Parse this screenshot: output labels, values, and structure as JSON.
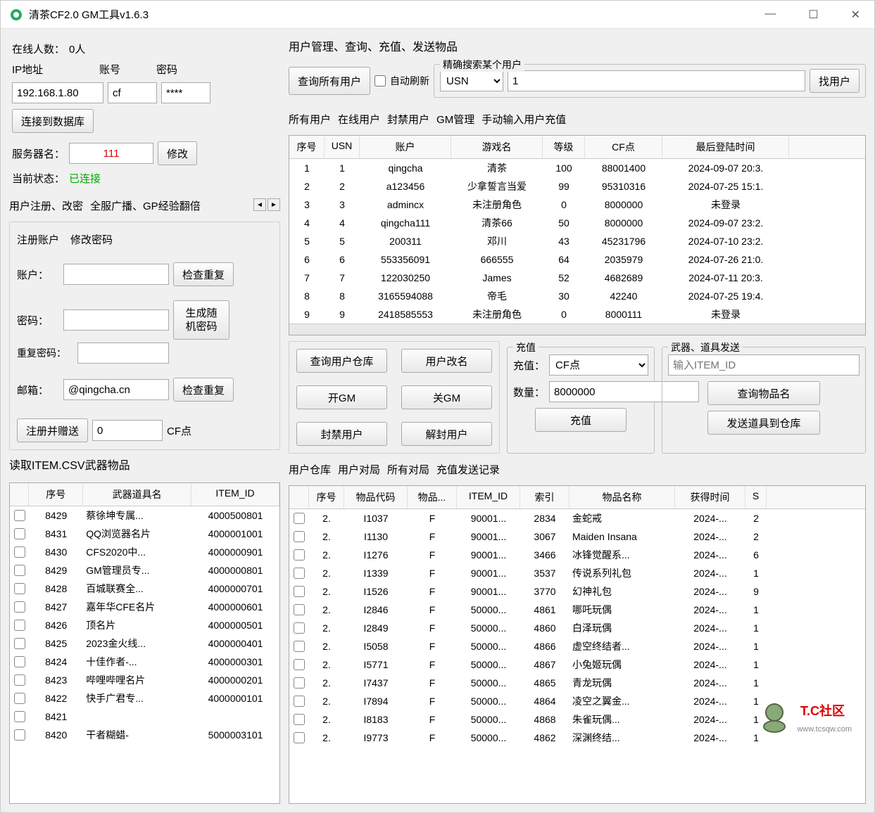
{
  "title": "清茶CF2.0 GM工具v1.6.3",
  "online": {
    "label": "在线人数：",
    "value": "0人"
  },
  "conn": {
    "ip_label": "IP地址",
    "ip": "192.168.1.80",
    "acct_label": "账号",
    "acct": "cf",
    "pwd_label": "密码",
    "pwd": "****",
    "connect_btn": "连接到数据库",
    "server_label": "服务器名：",
    "server": "111",
    "modify_btn": "修改",
    "status_label": "当前状态：",
    "status_value": "已连接"
  },
  "reg_tabs": {
    "t1": "用户注册、改密",
    "t2": "全服广播、GP经验翻倍"
  },
  "sub_tabs": {
    "t1": "注册账户",
    "t2": "修改密码"
  },
  "reg": {
    "acct_label": "账户：",
    "check_dup": "检查重复",
    "pwd_label": "密码：",
    "repwd_label": "重复密码：",
    "gen_pwd": "生成随机密码",
    "email_label": "邮箱：",
    "email": "@qingcha.cn",
    "submit": "注册并赠送",
    "cf_value": "0",
    "cf_suffix": "CF点"
  },
  "csv_title": "读取ITEM.CSV武器物品",
  "csv": {
    "headers": [
      "序号",
      "武器道具名",
      "ITEM_ID"
    ],
    "rows": [
      [
        "8429",
        "蔡徐坤专属...",
        "4000500801"
      ],
      [
        "8431",
        "QQ浏览器名片",
        "4000001001"
      ],
      [
        "8430",
        "CFS2020中...",
        "4000000901"
      ],
      [
        "8429",
        "GM管理员专...",
        "4000000801"
      ],
      [
        "8428",
        "百城联赛全...",
        "4000000701"
      ],
      [
        "8427",
        "嘉年华CFE名片",
        "4000000601"
      ],
      [
        "8426",
        "顶名片",
        "4000000501"
      ],
      [
        "8425",
        "2023金火线...",
        "4000000401"
      ],
      [
        "8424",
        "十佳作者-...",
        "4000000301"
      ],
      [
        "8423",
        "哔哩哔哩名片",
        "4000000201"
      ],
      [
        "8422",
        "快手广君专...",
        "4000000101"
      ],
      [
        "8421",
        "",
        ""
      ],
      [
        "8420",
        "干者糊蜡-",
        "5000003101"
      ]
    ]
  },
  "mgmt_title": "用户管理、查询、充值、发送物品",
  "mgmt": {
    "query_all": "查询所有用户",
    "auto_refresh": "自动刷新",
    "search_label": "精确搜索某个用户",
    "search_type": "USN",
    "search_val": "1",
    "search_btn": "找用户"
  },
  "user_tabs": {
    "t1": "所有用户",
    "t2": "在线用户",
    "t3": "封禁用户",
    "t4": "GM管理",
    "t5": "手动输入用户充值"
  },
  "users": {
    "headers": [
      "序号",
      "USN",
      "账户",
      "游戏名",
      "等级",
      "CF点",
      "最后登陆时间"
    ],
    "rows": [
      [
        "1",
        "1",
        "qingcha",
        "清茶",
        "100",
        "88001400",
        "2024-09-07 20:3."
      ],
      [
        "2",
        "2",
        "a123456",
        "少拿誓言当爱",
        "99",
        "95310316",
        "2024-07-25 15:1."
      ],
      [
        "3",
        "3",
        "admincx",
        "未注册角色",
        "0",
        "8000000",
        "未登录"
      ],
      [
        "4",
        "4",
        "qingcha111",
        "清茶66",
        "50",
        "8000000",
        "2024-09-07 23:2."
      ],
      [
        "5",
        "5",
        "200311",
        "邓川",
        "43",
        "45231796",
        "2024-07-10 23:2."
      ],
      [
        "6",
        "6",
        "553356091",
        "666555",
        "64",
        "2035979",
        "2024-07-26 21:0."
      ],
      [
        "7",
        "7",
        "122030250",
        "James",
        "52",
        "4682689",
        "2024-07-11 20:3."
      ],
      [
        "8",
        "8",
        "3165594088",
        "帝毛",
        "30",
        "42240",
        "2024-07-25 19:4."
      ],
      [
        "9",
        "9",
        "2418585553",
        "未注册角色",
        "0",
        "8000111",
        "未登录"
      ]
    ]
  },
  "actions": {
    "query_wh": "查询用户仓库",
    "rename": "用户改名",
    "open_gm": "开GM",
    "close_gm": "关GM",
    "ban": "封禁用户",
    "unban": "解封用户",
    "recharge_legend": "充值",
    "recharge_label": "充值：",
    "recharge_type": "CF点",
    "qty_label": "数量：",
    "qty": "8000000",
    "recharge_btn": "充值",
    "item_legend": "武器、道具发送",
    "item_placeholder": "输入ITEM_ID",
    "query_item": "查询物品名",
    "send_item": "发送道具到仓库"
  },
  "wh_tabs": {
    "t1": "用户仓库",
    "t2": "用户对局",
    "t3": "所有对局",
    "t4": "充值发送记录"
  },
  "wh": {
    "headers": [
      "序号",
      "物品代码",
      "物品...",
      "ITEM_ID",
      "索引",
      "物品名称",
      "获得时间",
      "S"
    ],
    "rows": [
      [
        "2.",
        "I1037",
        "F",
        "90001...",
        "2834",
        "金蛇戒",
        "2024-...",
        "2"
      ],
      [
        "2.",
        "I1130",
        "F",
        "90001...",
        "3067",
        "Maiden Insana",
        "2024-...",
        "2"
      ],
      [
        "2.",
        "I1276",
        "F",
        "90001...",
        "3466",
        "冰锋觉醒系...",
        "2024-...",
        "6"
      ],
      [
        "2.",
        "I1339",
        "F",
        "90001...",
        "3537",
        "传说系列礼包",
        "2024-...",
        "1"
      ],
      [
        "2.",
        "I1526",
        "F",
        "90001...",
        "3770",
        "幻神礼包",
        "2024-...",
        "9"
      ],
      [
        "2.",
        "I2846",
        "F",
        "50000...",
        "4861",
        "哪吒玩偶",
        "2024-...",
        "1"
      ],
      [
        "2.",
        "I2849",
        "F",
        "50000...",
        "4860",
        "白泽玩偶",
        "2024-...",
        "1"
      ],
      [
        "2.",
        "I5058",
        "F",
        "50000...",
        "4866",
        "虚空终结者...",
        "2024-...",
        "1"
      ],
      [
        "2.",
        "I5771",
        "F",
        "50000...",
        "4867",
        "小兔姬玩偶",
        "2024-...",
        "1"
      ],
      [
        "2.",
        "I7437",
        "F",
        "50000...",
        "4865",
        "青龙玩偶",
        "2024-...",
        "1"
      ],
      [
        "2.",
        "I7894",
        "F",
        "50000...",
        "4864",
        "凌空之翼金...",
        "2024-...",
        "1"
      ],
      [
        "2.",
        "I8183",
        "F",
        "50000...",
        "4868",
        "朱雀玩偶...",
        "2024-...",
        "1"
      ],
      [
        "2.",
        "I9773",
        "F",
        "50000...",
        "4862",
        "深渊终结...",
        "2024-...",
        "1"
      ]
    ]
  },
  "watermark": {
    "text": "T.C社区",
    "sub": "www.tcsqw.com"
  }
}
